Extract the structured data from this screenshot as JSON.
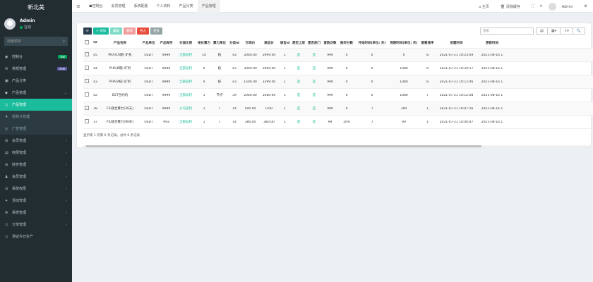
{
  "brand": "新北美",
  "user": {
    "name": "Admin",
    "status": "在线"
  },
  "sidebar_search": {
    "placeholder": "搜索菜单"
  },
  "menu": [
    {
      "label": "控制台",
      "badge": "hot",
      "badge_color": "#00a65a",
      "active": false
    },
    {
      "label": "常规管理",
      "badge": "new",
      "badge_color": "#605ca8",
      "active": false
    },
    {
      "label": "产品分类",
      "active": false
    },
    {
      "label": "产品管理",
      "active": false,
      "chevron": "⌄"
    },
    {
      "label": "产品管理",
      "active": true
    },
    {
      "label": "抢购计管理",
      "sub": true
    },
    {
      "label": "广告管理",
      "sub": true
    },
    {
      "label": "会员管理",
      "chevron": "‹"
    },
    {
      "label": "权限管理",
      "chevron": "‹"
    },
    {
      "label": "财务管理",
      "chevron": "‹"
    },
    {
      "label": "会员管理",
      "chevron": "‹"
    },
    {
      "label": "系统权限",
      "chevron": "‹"
    },
    {
      "label": "活动管理",
      "chevron": "‹"
    },
    {
      "label": "系统管理",
      "chevron": "‹"
    },
    {
      "label": "订单管理",
      "chevron": "‹"
    },
    {
      "label": "测试今日生产"
    }
  ],
  "topbar": {
    "tabs": [
      "控制台",
      "会员管理",
      "系统配置",
      "个人资料",
      "产品分类",
      "产品管理"
    ],
    "right": [
      "主页",
      "清除缓存",
      "Admin"
    ]
  },
  "toolbar": {
    "buttons": [
      {
        "label": "⟳",
        "color": "#2c3e50"
      },
      {
        "label": "+ 添加",
        "color": "#18bc9c"
      },
      {
        "label": "编辑",
        "color": "#7ddcc7"
      },
      {
        "label": "删除",
        "color": "#f39c9c"
      },
      {
        "label": "导入",
        "color": "#e74c3c"
      },
      {
        "label": "更多",
        "color": "#95a5a6"
      }
    ],
    "search_placeholder": "搜索",
    "tools": [
      "▤",
      "▦▾",
      "⇩▾",
      "🔍"
    ]
  },
  "table": {
    "columns": [
      "",
      "ID",
      "产品名称",
      "产品单位",
      "产品库存",
      "分润比例",
      "单价算力",
      "算力单位",
      "分类id",
      "市场价",
      "商品价",
      "语言id",
      "是否上架",
      "是否热门",
      "复购次数",
      "购买分数",
      "开始时间(单位: 天)",
      "到期时间(单位: 天)",
      "销售排序",
      "创建时间",
      "更新时间"
    ],
    "rows": [
      [
        "",
        "45",
        "PHA(10期) 矿机",
        "USDT",
        "9999",
        "全部返利",
        "10",
        "核",
        "43",
        "3000.00",
        "2999.00",
        "1",
        "是",
        "是",
        "999",
        "0",
        "0",
        "0",
        "8",
        "2021-07-21 10:23:09",
        "2021-08-16 1"
      ],
      [
        "",
        "44",
        "PHA(8期) 矿机",
        "USDT",
        "9999",
        "全部返利",
        "6",
        "核",
        "43",
        "3000.00",
        "2099.00",
        "1",
        "是",
        "是",
        "999",
        "0",
        "0",
        "1080",
        "8",
        "2021-07-21 10:20:17",
        "2021-08-16 1"
      ],
      [
        "",
        "43",
        "PHA(4核) 矿机",
        "USDT",
        "9999",
        "全部返利",
        "4",
        "核",
        "43",
        "1500.00",
        "1299.00",
        "1",
        "是",
        "是",
        "999",
        "0",
        "0",
        "1080",
        "8",
        "2021-07-21 10:15:46",
        "2021-08-16 1"
      ],
      [
        "",
        "42",
        "B2T合约机",
        "USDT",
        "9999",
        "全部返利",
        "1",
        "节点",
        "39",
        "2000.00",
        "1080.00",
        "1",
        "是",
        "是",
        "999",
        "0",
        "0",
        "1080",
        "7",
        "2021-07-21 10:12:08",
        "2021-08-16 1"
      ],
      [
        "",
        "38",
        "FIL联合算力(30天)",
        "USDT",
        "9999",
        "公司返利",
        "1",
        "T",
        "14",
        "500.00",
        "0.00",
        "1",
        "是",
        "是",
        "999",
        "0",
        "7",
        "300",
        "1",
        "2021-07-21 10:07:16",
        "2021-08-16 1"
      ],
      [
        "",
        "37",
        "FIL联合算力(90天)",
        "USDT",
        "993",
        "全部返利",
        "1",
        "T",
        "14",
        "380.00",
        "380.00",
        "1",
        "是",
        "是",
        "99",
        "10%",
        "7",
        "90",
        "1",
        "2021-07-21 10:00:47",
        "2021-08-16 1"
      ]
    ]
  },
  "pager": "显示第 1 到第 6 条记录，总共 6 条记录"
}
